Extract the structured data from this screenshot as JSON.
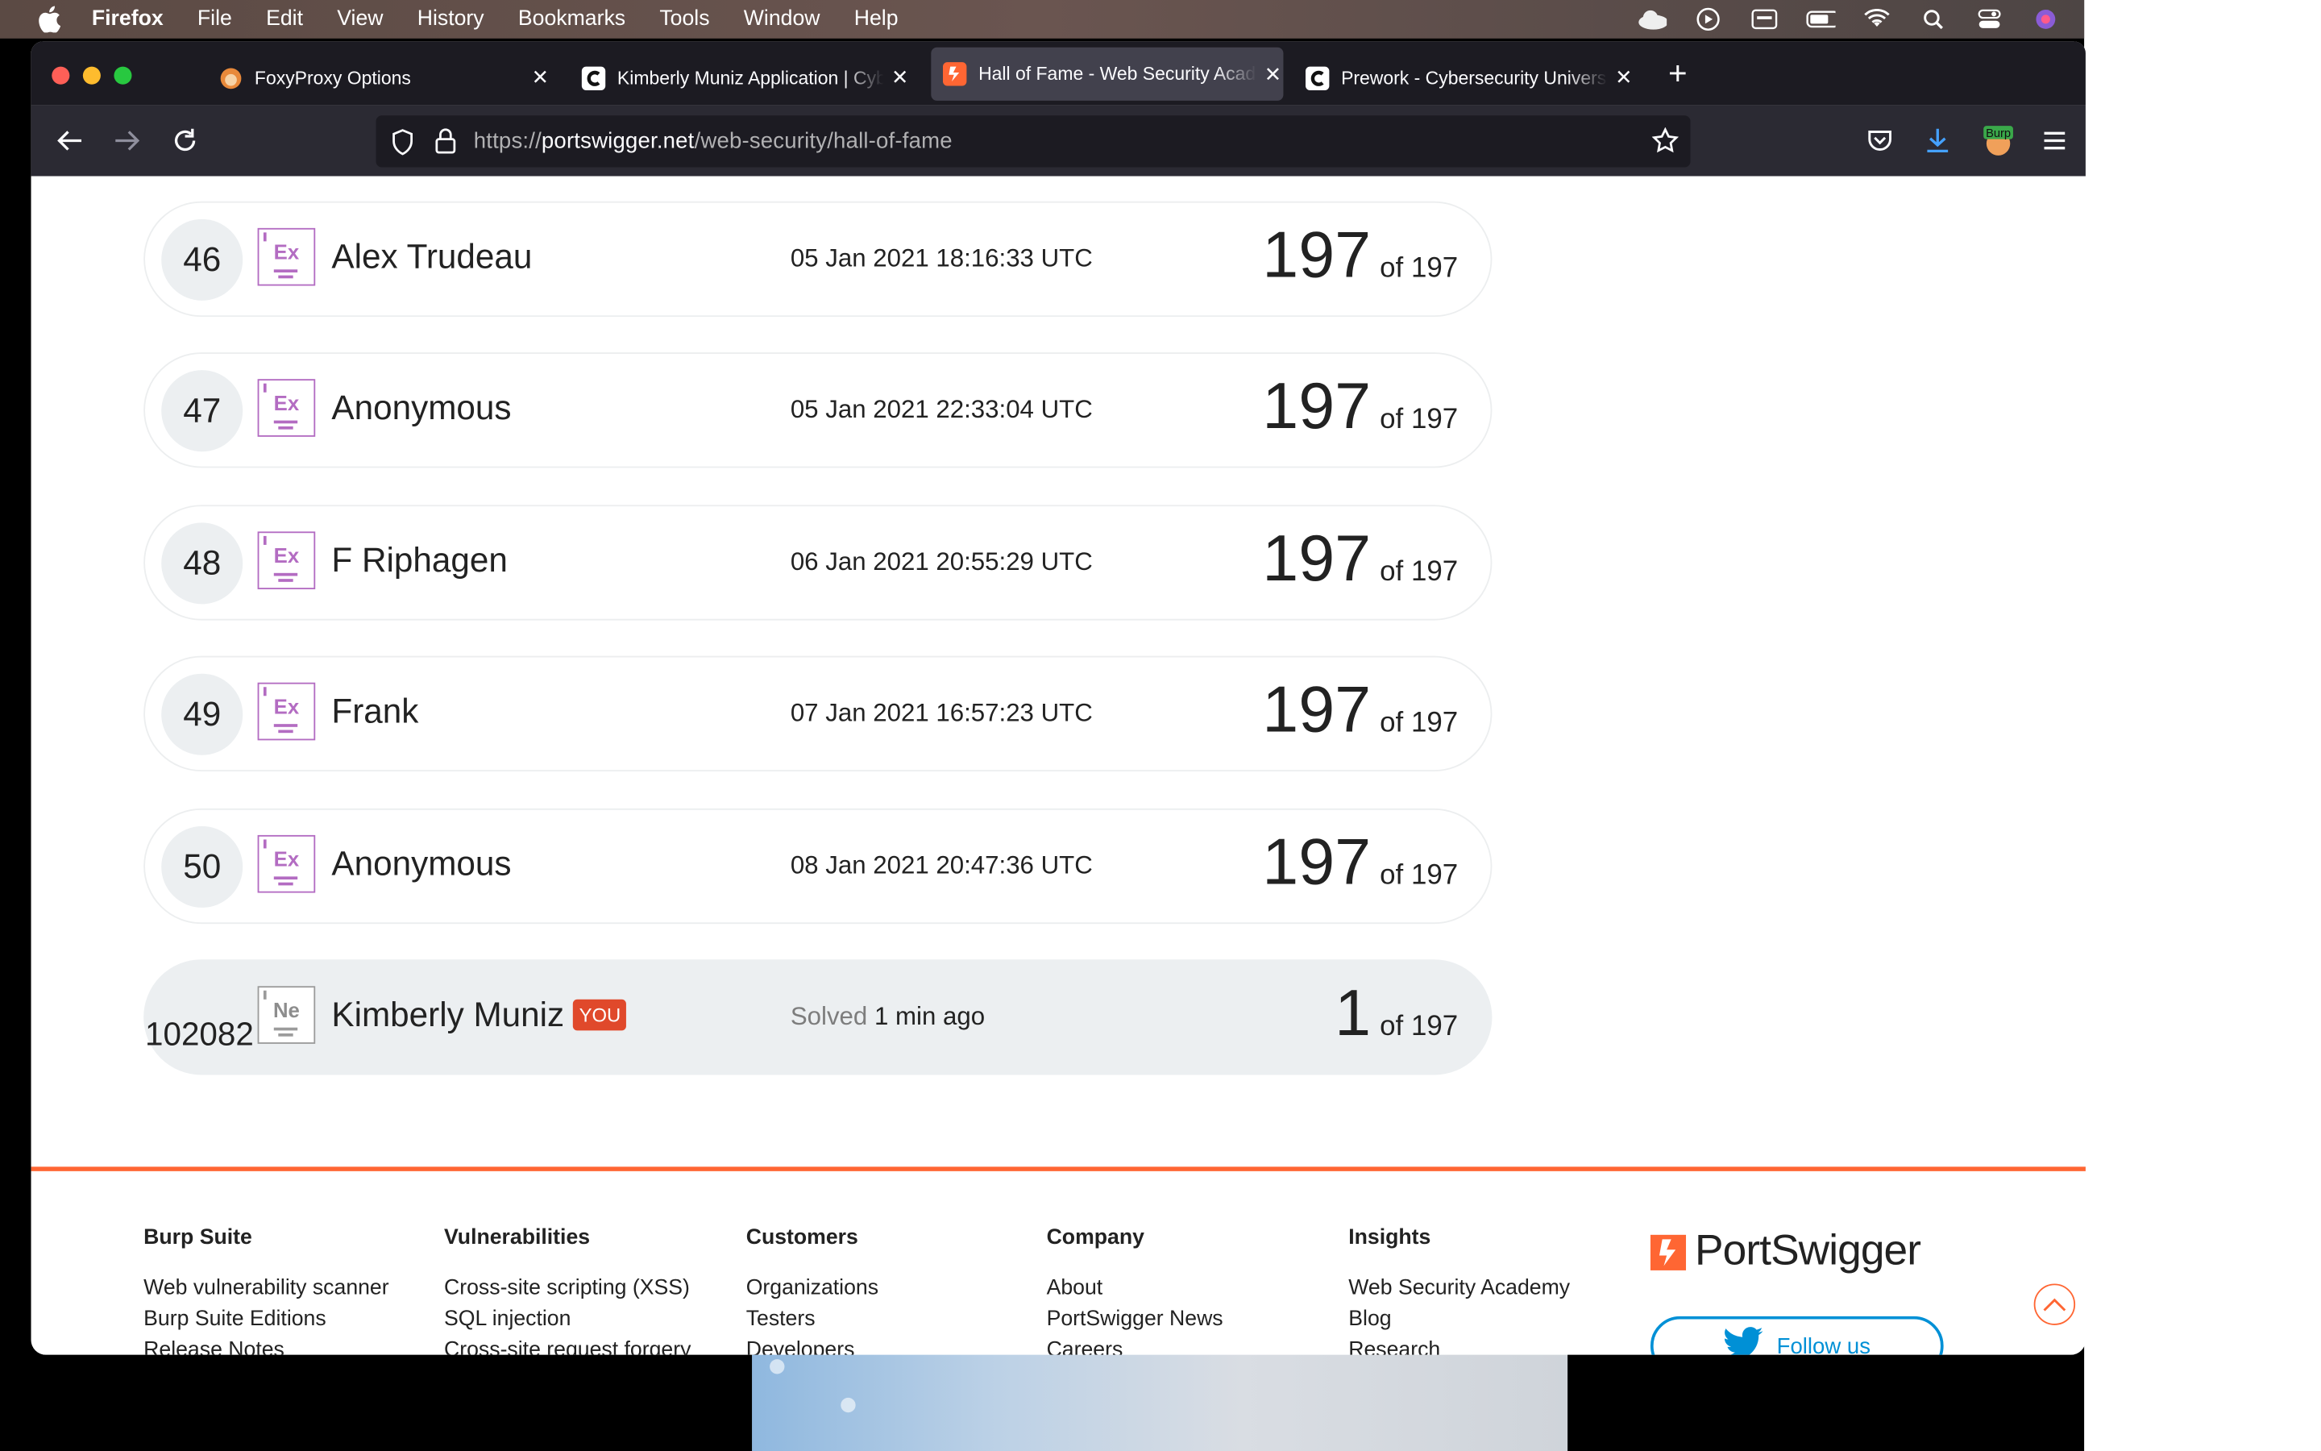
{
  "menubar": {
    "app": "Firefox",
    "items": [
      "File",
      "Edit",
      "View",
      "History",
      "Bookmarks",
      "Tools",
      "Window",
      "Help"
    ]
  },
  "tabs": [
    {
      "title": "FoxyProxy Options",
      "active": false
    },
    {
      "title": "Kimberly Muniz Application | Cybersecurity",
      "active": false
    },
    {
      "title": "Hall of Fame - Web Security Academy",
      "active": true
    },
    {
      "title": "Prework - Cybersecurity University",
      "active": false
    }
  ],
  "urlbar": {
    "scheme": "https://",
    "host": "portswigger.net",
    "path": "/web-security/hall-of-fame"
  },
  "leaderboard": {
    "rows": [
      {
        "rank": "46",
        "badge": "Ex",
        "name": "Alex Trudeau",
        "date": "05 Jan 2021 18:16:33 UTC",
        "score": "197",
        "of": "of 197"
      },
      {
        "rank": "47",
        "badge": "Ex",
        "name": "Anonymous",
        "date": "05 Jan 2021 22:33:04 UTC",
        "score": "197",
        "of": "of 197"
      },
      {
        "rank": "48",
        "badge": "Ex",
        "name": "F Riphagen",
        "date": "06 Jan 2021 20:55:29 UTC",
        "score": "197",
        "of": "of 197"
      },
      {
        "rank": "49",
        "badge": "Ex",
        "name": "Frank",
        "date": "07 Jan 2021 16:57:23 UTC",
        "score": "197",
        "of": "of 197"
      },
      {
        "rank": "50",
        "badge": "Ex",
        "name": "Anonymous",
        "date": "08 Jan 2021 20:47:36 UTC",
        "score": "197",
        "of": "of 197"
      }
    ],
    "me": {
      "rank": "102082",
      "badge": "Ne",
      "name": "Kimberly Muniz",
      "you": "YOU",
      "solved_label": "Solved",
      "solved_time": "1 min ago",
      "score": "1",
      "of": "of 197"
    }
  },
  "footer": {
    "columns": [
      {
        "heading": "Burp Suite",
        "links": [
          "Web vulnerability scanner",
          "Burp Suite Editions",
          "Release Notes"
        ]
      },
      {
        "heading": "Vulnerabilities",
        "links": [
          "Cross-site scripting (XSS)",
          "SQL injection",
          "Cross-site request forgery"
        ]
      },
      {
        "heading": "Customers",
        "links": [
          "Organizations",
          "Testers",
          "Developers"
        ]
      },
      {
        "heading": "Company",
        "links": [
          "About",
          "PortSwigger News",
          "Careers"
        ]
      },
      {
        "heading": "Insights",
        "links": [
          "Web Security Academy",
          "Blog",
          "Research"
        ]
      }
    ],
    "logo_text": "PortSwigger",
    "follow_label": "Follow us"
  },
  "colors": {
    "accent": "#ff6633",
    "badge_expert": "#b36cc2",
    "twitter": "#0090d6"
  }
}
